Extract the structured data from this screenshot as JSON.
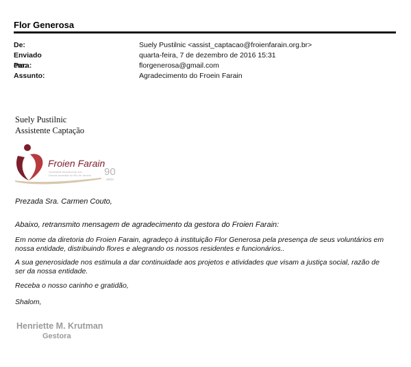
{
  "title": "Flor Generosa",
  "header": {
    "rows": [
      {
        "key": "De:",
        "value": "Suely Pustilnic <assist_captacao@froienfarain.org.br>"
      },
      {
        "key": "Enviado em:",
        "value": "quarta-feira, 7 de dezembro de 2016 15:31"
      },
      {
        "key": "Para:",
        "value": "florgenerosa@gmail.com"
      },
      {
        "key": "Assunto:",
        "value": "Agradecimento do Froein Farain"
      }
    ]
  },
  "sender": {
    "name": "Suely Pustilnic",
    "role": "Assistente Captação"
  },
  "logo": {
    "name": "Froien Farain",
    "tagline_1": "Sociedade Beneficente dos",
    "tagline_2": "Damas Israelitas do Rio de Janeiro",
    "anniversary": "90",
    "anniversary_word": "anos",
    "colors": {
      "maroon": "#7a1f2b",
      "red": "#b73a3f",
      "beige": "#d8c7ad",
      "gray": "#b5b5b5"
    }
  },
  "message": {
    "greeting": "Prezada Sra. Carmen Couto,",
    "intro": "Abaixo, retransmito mensagem de agradecimento da gestora do Froien Farain:",
    "p1": "Em nome da diretoria do Froien Farain, agradeço à instituição Flor Generosa pela presença de seus voluntários em nossa entidade, distribuindo flores e alegrando os nossos residentes e funcionários..",
    "p2": "A sua generosidade nos estimula  a dar continuidade aos projetos e atividades que visam a justiça social, razão de ser da nossa entidade.",
    "p3": "Receba o nosso carinho e gratidão,",
    "p4": "Shalom,"
  },
  "signature": {
    "name": "Henriette M. Krutman",
    "role": "Gestora"
  }
}
